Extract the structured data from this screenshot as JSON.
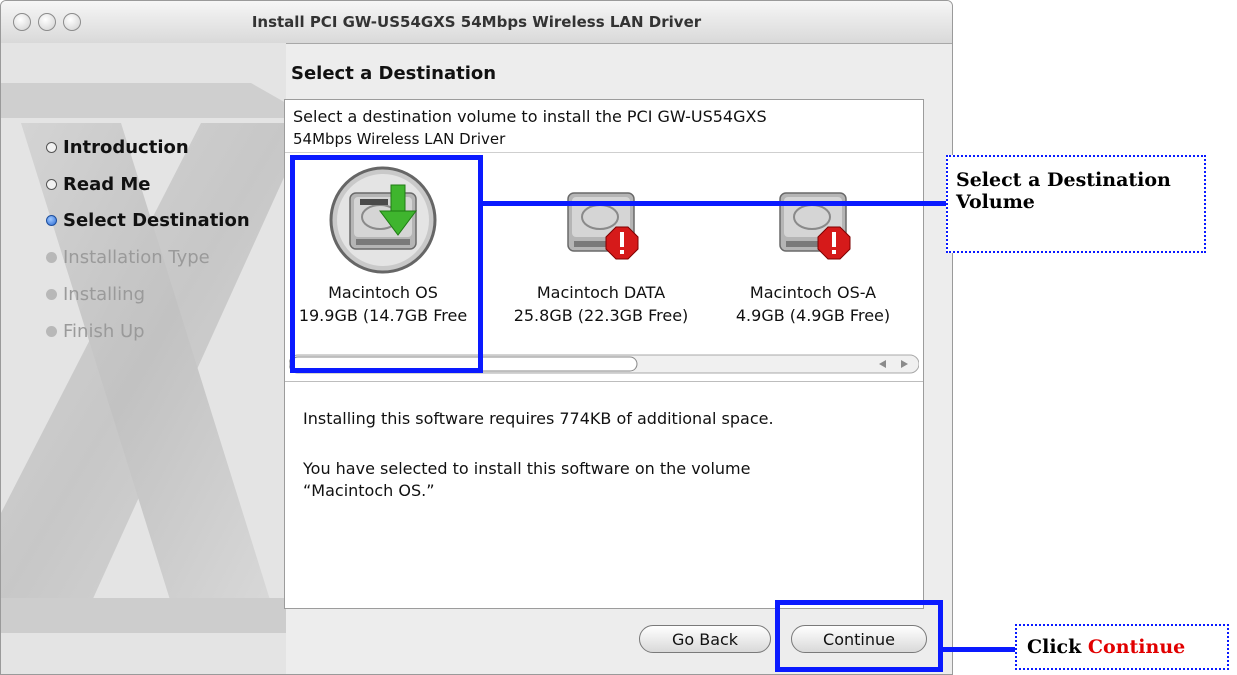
{
  "window": {
    "title": "Install PCI GW-US54GXS 54Mbps Wireless LAN Driver"
  },
  "steps": [
    {
      "label": "Introduction",
      "state": "done"
    },
    {
      "label": "Read Me",
      "state": "done"
    },
    {
      "label": "Select Destination",
      "state": "current"
    },
    {
      "label": "Installation Type",
      "state": "todo"
    },
    {
      "label": "Installing",
      "state": "todo"
    },
    {
      "label": "Finish Up",
      "state": "todo"
    }
  ],
  "main": {
    "section_title": "Select a Destination",
    "intro_line1": "Select a destination volume to install the PCI GW-US54GXS",
    "intro_line2": "54Mbps Wireless LAN Driver",
    "volumes": [
      {
        "name": "Macintoch OS",
        "size": "19.9GB (14.7GB Free",
        "badge": "install-arrow",
        "selected": true
      },
      {
        "name": "Macintoch DATA",
        "size": "25.8GB (22.3GB Free)",
        "badge": "alert",
        "selected": false
      },
      {
        "name": "Macintoch OS-A",
        "size": "4.9GB (4.9GB Free)",
        "badge": "alert",
        "selected": false
      }
    ],
    "message1": "Installing this software requires 774KB of additional space.",
    "message2_line1": "You have selected to install this software on the volume",
    "message2_line2": "“Macintoch OS.”"
  },
  "buttons": {
    "back": "Go Back",
    "continue": "Continue"
  },
  "annotations": {
    "callout1_line1": "Select a Destination",
    "callout1_line2": "Volume",
    "callout2_prefix": "Click ",
    "callout2_highlight": "Continue"
  },
  "colors": {
    "highlight": "#0a1aff",
    "callout_text_highlight": "#e10000",
    "current_step": "#2a6ad3"
  }
}
